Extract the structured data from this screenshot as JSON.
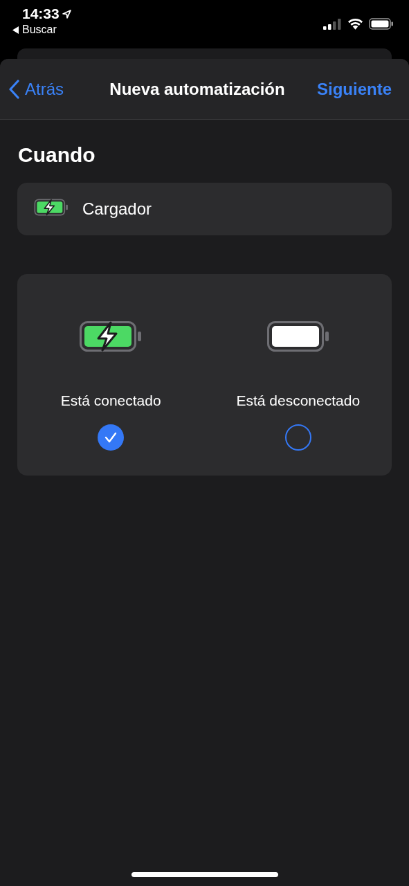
{
  "status_bar": {
    "time": "14:33",
    "back_app": "Buscar"
  },
  "nav": {
    "back": "Atrás",
    "title": "Nueva automatización",
    "next": "Siguiente"
  },
  "section_title": "Cuando",
  "trigger": {
    "label": "Cargador"
  },
  "options": [
    {
      "label": "Está conectado",
      "kind": "charging",
      "selected": true
    },
    {
      "label": "Está desconectado",
      "kind": "empty",
      "selected": false
    }
  ]
}
